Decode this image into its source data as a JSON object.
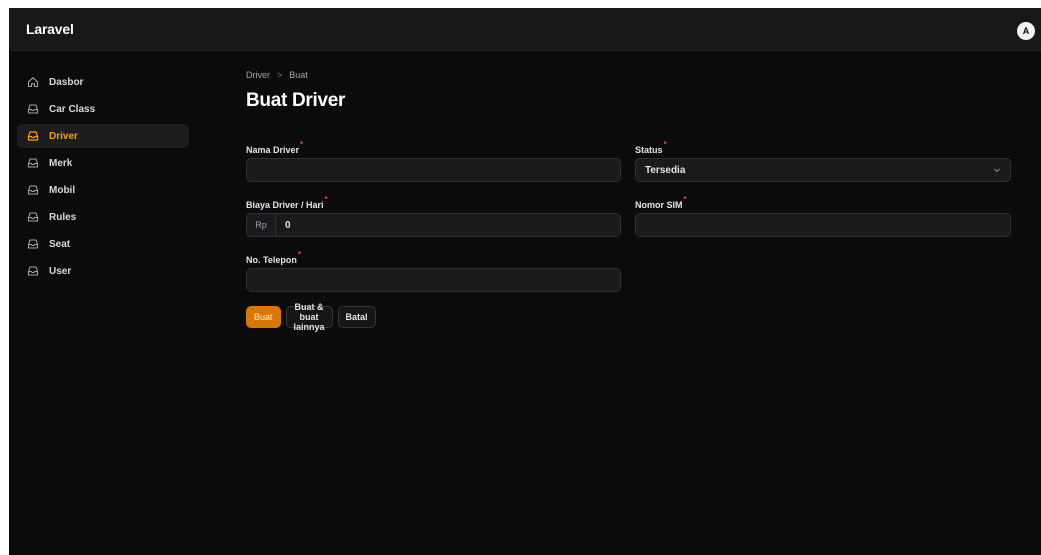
{
  "app": {
    "brand": "Laravel",
    "user_initial": "A"
  },
  "sidebar": {
    "items": [
      {
        "label": "Dasbor",
        "icon": "home-icon",
        "active": false
      },
      {
        "label": "Car Class",
        "icon": "inbox-icon",
        "active": false
      },
      {
        "label": "Driver",
        "icon": "inbox-icon",
        "active": true
      },
      {
        "label": "Merk",
        "icon": "inbox-icon",
        "active": false
      },
      {
        "label": "Mobil",
        "icon": "inbox-icon",
        "active": false
      },
      {
        "label": "Rules",
        "icon": "inbox-icon",
        "active": false
      },
      {
        "label": "Seat",
        "icon": "inbox-icon",
        "active": false
      },
      {
        "label": "User",
        "icon": "inbox-icon",
        "active": false
      }
    ]
  },
  "breadcrumb": {
    "parent": "Driver",
    "separator": ">",
    "current": "Buat"
  },
  "page": {
    "title": "Buat Driver"
  },
  "form": {
    "required_mark": "*",
    "nama_driver": {
      "label": "Nama Driver",
      "value": "",
      "placeholder": ""
    },
    "status": {
      "label": "Status",
      "value": "Tersedia"
    },
    "biaya": {
      "label": "Biaya Driver / Hari",
      "prefix": "Rp",
      "value": "0"
    },
    "nomor_sim": {
      "label": "Nomor SIM",
      "value": "",
      "placeholder": ""
    },
    "telepon": {
      "label": "No. Telepon",
      "value": "",
      "placeholder": ""
    }
  },
  "actions": {
    "create": "Buat",
    "create_another": "Buat & buat lainnya",
    "cancel": "Batal"
  },
  "colors": {
    "accent": "#d97706",
    "active_text": "#f59e0b",
    "required": "#ef4444",
    "background": "#0b0b0c",
    "topbar": "#18181b"
  }
}
